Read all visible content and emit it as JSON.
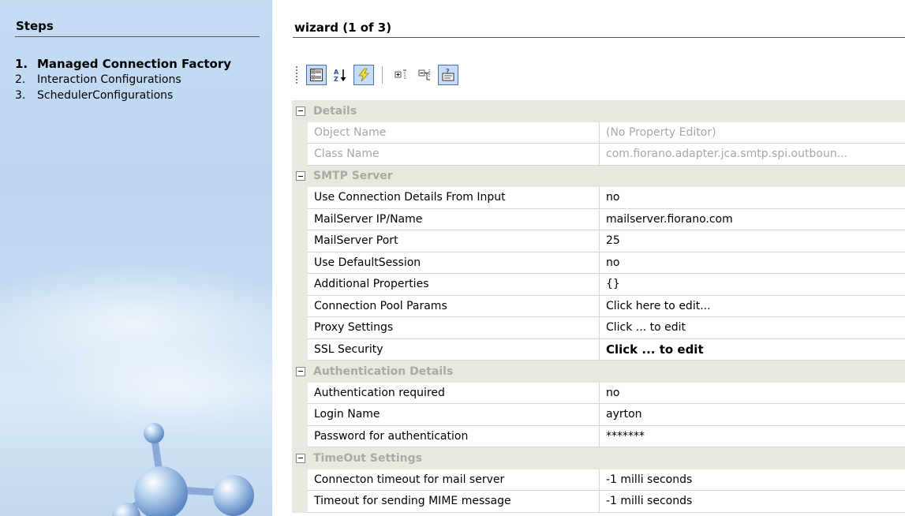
{
  "steps": {
    "title": "Steps",
    "items": [
      {
        "num": "1.",
        "label": "Managed Connection Factory"
      },
      {
        "num": "2.",
        "label": "Interaction Configurations"
      },
      {
        "num": "3.",
        "label": "SchedulerConfigurations"
      }
    ],
    "active_index": 0
  },
  "wizard": {
    "title": "wizard (1 of 3)"
  },
  "toolbar": {
    "buttons": [
      {
        "icon": "categorized-icon",
        "checked": true
      },
      {
        "icon": "alphabetical-sort-icon",
        "checked": false
      },
      {
        "icon": "events-lightning-icon",
        "checked": true
      },
      {
        "icon": "expand-all-icon",
        "checked": false
      },
      {
        "icon": "collapse-all-icon",
        "checked": false
      },
      {
        "icon": "help-description-icon",
        "checked": true
      }
    ]
  },
  "property_grid": {
    "categories": [
      {
        "name": "Details",
        "rows": [
          {
            "name": "Object Name",
            "value": "(No Property Editor)",
            "readonly": true
          },
          {
            "name": "Class Name",
            "value": "com.fiorano.adapter.jca.smtp.spi.outboun...",
            "readonly": true
          }
        ]
      },
      {
        "name": "SMTP Server",
        "rows": [
          {
            "name": "Use Connection Details From Input",
            "value": "no"
          },
          {
            "name": "MailServer IP/Name",
            "value": "mailserver.fiorano.com"
          },
          {
            "name": "MailServer Port",
            "value": "25"
          },
          {
            "name": "Use DefaultSession",
            "value": "no"
          },
          {
            "name": "Additional Properties",
            "value": "{}"
          },
          {
            "name": "Connection Pool Params",
            "value": "Click here to edit..."
          },
          {
            "name": "Proxy Settings",
            "value": "Click ... to edit"
          },
          {
            "name": "SSL Security",
            "value": "Click ... to edit",
            "bold": true
          }
        ]
      },
      {
        "name": "Authentication Details",
        "rows": [
          {
            "name": "Authentication required",
            "value": "no"
          },
          {
            "name": "Login Name",
            "value": "ayrton"
          },
          {
            "name": "Password for authentication",
            "value": "*******"
          }
        ]
      },
      {
        "name": "TimeOut Settings",
        "rows": [
          {
            "name": "Connecton timeout for mail server",
            "value": "-1  milli seconds"
          },
          {
            "name": "Timeout for sending MIME message",
            "value": "-1  milli seconds"
          }
        ]
      }
    ]
  },
  "colors": {
    "category_bg": "#e9e8e0",
    "category_text": "#aaa9a3",
    "readonly_text": "#a7a7a7",
    "toolbar_checked_bg": "#c7daf6",
    "panel_sky": "#c5dcf3"
  }
}
